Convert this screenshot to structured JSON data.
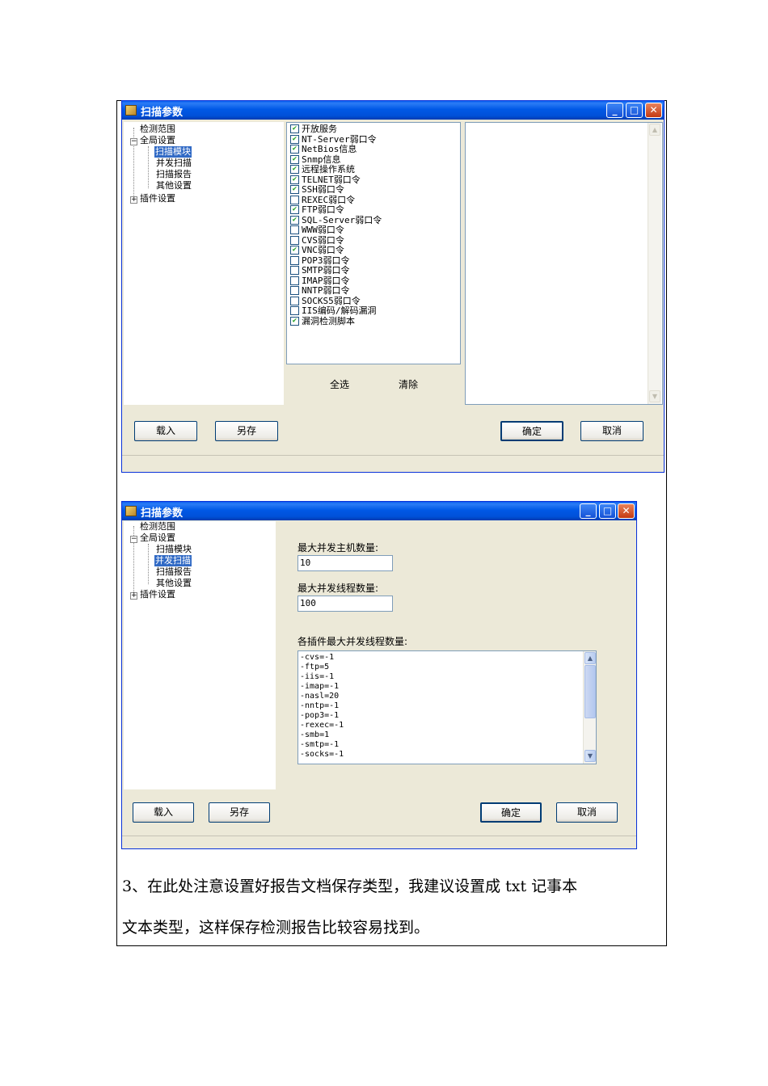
{
  "window1": {
    "title": "扫描参数",
    "tree": {
      "items": [
        "检测范围",
        "全局设置",
        "扫描模块",
        "并发扫描",
        "扫描报告",
        "其他设置",
        "插件设置"
      ],
      "selected_index": 2
    },
    "modules": [
      {
        "label": "开放服务",
        "checked": true
      },
      {
        "label": "NT-Server弱口令",
        "checked": true
      },
      {
        "label": "NetBios信息",
        "checked": true
      },
      {
        "label": "Snmp信息",
        "checked": true
      },
      {
        "label": "远程操作系统",
        "checked": true
      },
      {
        "label": "TELNET弱口令",
        "checked": true
      },
      {
        "label": "SSH弱口令",
        "checked": true
      },
      {
        "label": "REXEC弱口令",
        "checked": false
      },
      {
        "label": "FTP弱口令",
        "checked": true
      },
      {
        "label": "SQL-Server弱口令",
        "checked": true
      },
      {
        "label": "WWW弱口令",
        "checked": false
      },
      {
        "label": "CVS弱口令",
        "checked": false
      },
      {
        "label": "VNC弱口令",
        "checked": true
      },
      {
        "label": "POP3弱口令",
        "checked": false
      },
      {
        "label": "SMTP弱口令",
        "checked": false
      },
      {
        "label": "IMAP弱口令",
        "checked": false
      },
      {
        "label": "NNTP弱口令",
        "checked": false
      },
      {
        "label": "SOCKS5弱口令",
        "checked": false
      },
      {
        "label": "IIS编码/解码漏洞",
        "checked": false
      },
      {
        "label": "漏洞检测脚本",
        "checked": true
      }
    ],
    "select_all_label": "全选",
    "clear_label": "清除",
    "load_label": "载入",
    "save_as_label": "另存",
    "ok_label": "确定",
    "cancel_label": "取消"
  },
  "window2": {
    "title": "扫描参数",
    "tree": {
      "items": [
        "检测范围",
        "全局设置",
        "扫描模块",
        "并发扫描",
        "扫描报告",
        "其他设置",
        "插件设置"
      ],
      "selected_index": 3
    },
    "max_hosts_label": "最大并发主机数量:",
    "max_hosts_value": "10",
    "max_threads_label": "最大并发线程数量:",
    "max_threads_value": "100",
    "plugin_threads_label": "各插件最大并发线程数量:",
    "plugin_threads_lines": [
      "-cvs=-1",
      "-ftp=5",
      "-iis=-1",
      "-imap=-1",
      "-nasl=20",
      "-nntp=-1",
      "-pop3=-1",
      "-rexec=-1",
      "-smb=1",
      "-smtp=-1",
      "-socks=-1"
    ],
    "load_label": "载入",
    "save_as_label": "另存",
    "ok_label": "确定",
    "cancel_label": "取消"
  },
  "doc": {
    "paragraph_line1": "3、在此处注意设置好报告文档保存类型，我建议设置成 txt 记事本",
    "paragraph_line2": "文本类型，这样保存检测报告比较容易找到。"
  },
  "colors": {
    "titlebar": "#0058e6",
    "dialog_bg": "#ece9d8",
    "selection": "#316ac5",
    "close_button": "#c43a12",
    "check_mark": "#21a121"
  }
}
